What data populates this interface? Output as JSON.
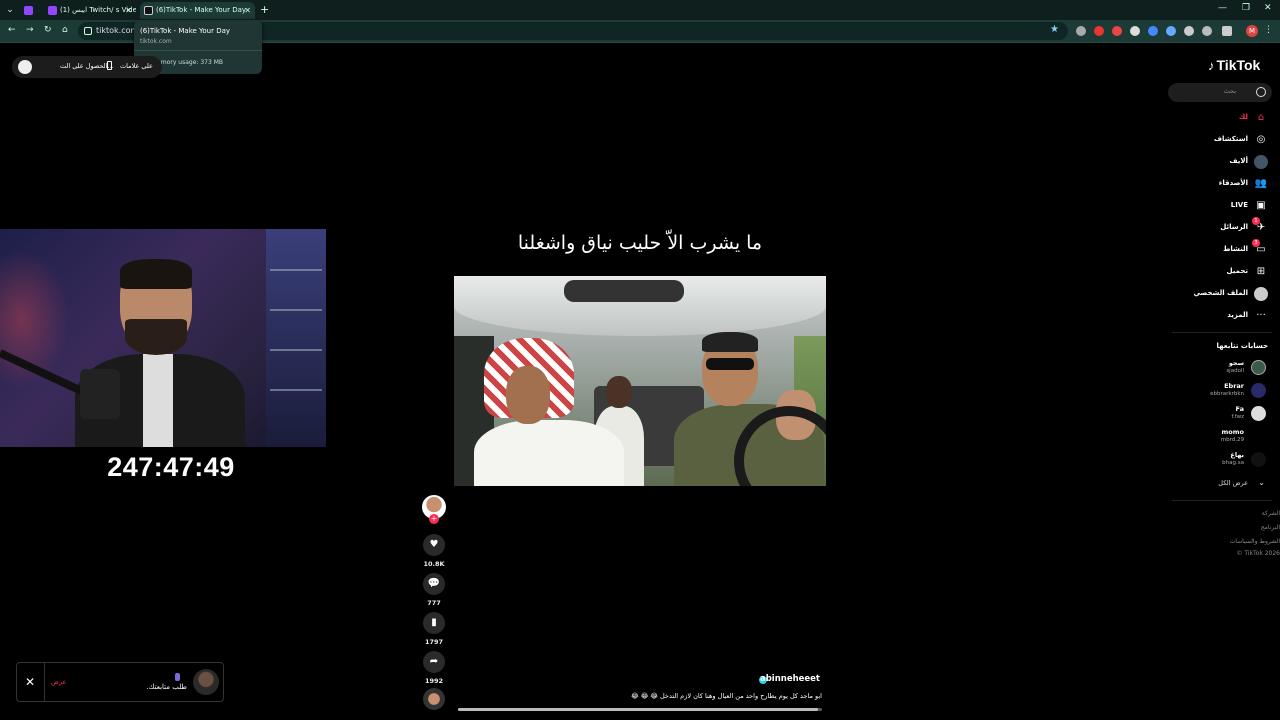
{
  "browser": {
    "tabs": [
      {
        "title": "",
        "favicon_color": "#9146ff"
      },
      {
        "title": "(1) ايبس Twitch/ s Videos -",
        "favicon_color": "#9146ff"
      },
      {
        "title": "(6)TikTok - Make Your Day",
        "favicon_color": "#111111"
      }
    ],
    "new_tab": "+",
    "url": "tiktok.com/",
    "profile_initial": "M",
    "hovercard": {
      "title": "(6)TikTok - Make Your Day",
      "domain": "tiktok.com",
      "memory": "Memory usage: 373 MB"
    }
  },
  "getapp": {
    "text1": "الحصول على الت...",
    "text2": "على علامات"
  },
  "stream": {
    "timer": "247:47:49"
  },
  "video": {
    "overlay_caption": "ما يشرب الاّ حليب نياق واشغلنا",
    "author": "abinneheeet",
    "description": "ابو ماجد كل يوم يطارح واحد من العيال وهنا كان لازم التدخل 😂 😂 😂",
    "progress": 0.99
  },
  "actions": {
    "likes": "10.8K",
    "comments": "777",
    "saves": "1797",
    "shares": "1992"
  },
  "sidebar": {
    "logo": "TikTok",
    "search_placeholder": "بحث",
    "nav": [
      {
        "label": "لك",
        "icon": "home-icon"
      },
      {
        "label": "استكشاف",
        "icon": "compass-icon"
      },
      {
        "label": "ألايف",
        "icon": "avatar-icon"
      },
      {
        "label": "الأصدقاء",
        "icon": "friends-icon"
      },
      {
        "label": "LIVE",
        "icon": "live-icon"
      },
      {
        "label": "الرسائل",
        "icon": "messages-icon",
        "badge": "1"
      },
      {
        "label": "النشاط",
        "icon": "activity-icon",
        "badge": "3"
      },
      {
        "label": "تحميل",
        "icon": "upload-icon"
      },
      {
        "label": "الملف الشخصي",
        "icon": "profile-icon"
      },
      {
        "label": "المزيد",
        "icon": "more-icon"
      }
    ],
    "following_title": "حسابات تتابعها",
    "accounts": [
      {
        "name": "سجو",
        "handle": "sjadoll"
      },
      {
        "name": "Ebrar",
        "handle": "ebbrarkrbkn"
      },
      {
        "name": "Fa",
        "handle": "f.fwz"
      },
      {
        "name": "momo",
        "handle": "mbrd.29"
      },
      {
        "name": "بهاغ",
        "handle": "bhag.sa"
      }
    ],
    "see_all": "عرض الكل",
    "footer": [
      "الشركة",
      "البرنامج",
      "الشروط والسياسات",
      "TikTok 2026 ©"
    ]
  },
  "notification": {
    "action": "عرض",
    "text": "طلب متابعتك."
  }
}
